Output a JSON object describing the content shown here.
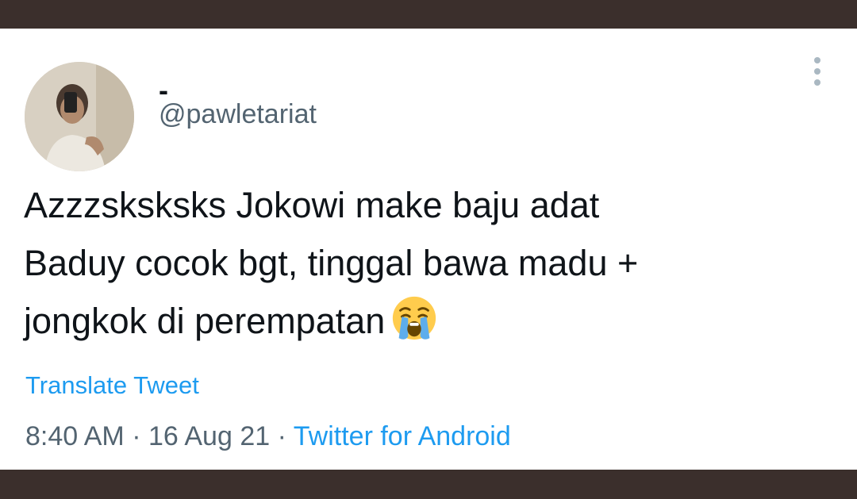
{
  "tweet": {
    "display_name": "-",
    "handle": "@pawletariat",
    "text_lines": [
      "Azzzsksksks Jokowi make baju adat",
      "Baduy cocok bgt, tinggal bawa madu +",
      "jongkok di perempatan"
    ],
    "emoji": "loudly-crying-face",
    "translate_label": "Translate Tweet",
    "time": "8:40 AM",
    "separator": "·",
    "date": "16 Aug 21",
    "source": "Twitter for Android"
  },
  "colors": {
    "text": "#0f1419",
    "secondary": "#536471",
    "link": "#1d9bf0",
    "border_frame": "#3b2f2c"
  }
}
